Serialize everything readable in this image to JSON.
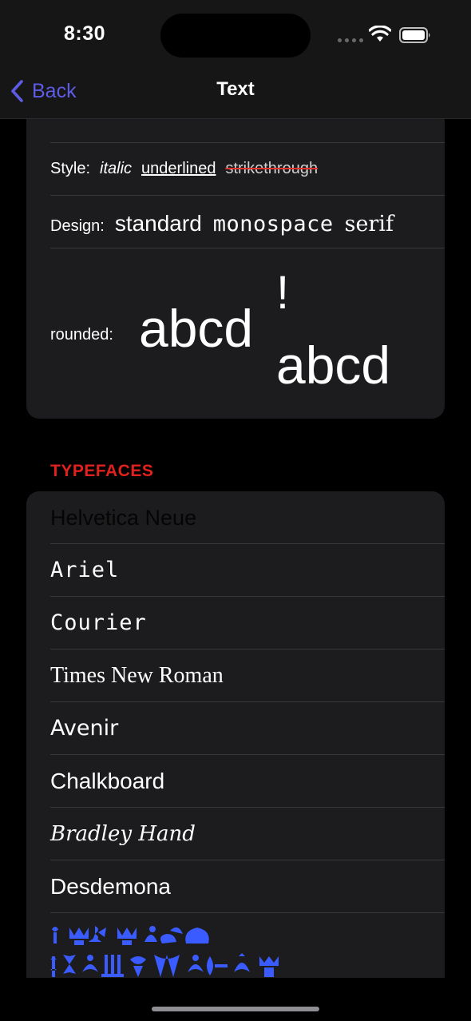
{
  "status_bar": {
    "time": "8:30"
  },
  "nav": {
    "back_label": "Back",
    "title": "Text"
  },
  "text_styles": {
    "style_label": "Style:",
    "style_italic": "italic",
    "style_underlined": "underlined",
    "style_strikethrough": "strikethrough",
    "design_label": "Design:",
    "design_standard": "standard",
    "design_monospace": "monospace",
    "design_serif": "serif",
    "rounded_label": "rounded:",
    "rounded_sample_1": "abcd",
    "rounded_exclamation": "!",
    "rounded_sample_2": "abcd"
  },
  "typefaces": {
    "header": "TYPEFACES",
    "items": [
      {
        "label": "Helvetica Neue"
      },
      {
        "label": "Ariel"
      },
      {
        "label": "Courier"
      },
      {
        "label": "Times New Roman"
      },
      {
        "label": "Avenir"
      },
      {
        "label": "Chalkboard"
      },
      {
        "label": "Bradley Hand"
      },
      {
        "label": "Desdemona"
      }
    ],
    "ornament_icon": "ornament-dingbats-icon"
  },
  "colors": {
    "accent": "#5e5ce6",
    "section_header": "#e0211d",
    "card_background": "#1c1c1e",
    "ornament": "#3a5bff"
  }
}
